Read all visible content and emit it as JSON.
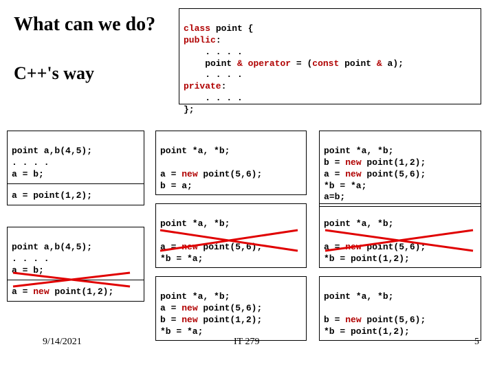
{
  "title": "What can we do?",
  "subtitle": "C++'s way",
  "classDef": "class point {\npublic:\n    . . . .\n    point & operator = (const point & a);\n    . . . .\nprivate:\n    . . . .\n};",
  "left1": "point a,b(4,5);\n. . . .\na = b;",
  "left1b": "a = point(1,2);",
  "left2": "point a,b(4,5);\n. . . .\na = b;",
  "left2b": "a = new point(1,2);",
  "mid1": "point *a, *b;\n\na = new point(5,6);\nb = a;",
  "mid2": "point *a, *b;\n\na = new point(5,6);\n*b = *a;",
  "mid3": "point *a, *b;\na = new point(5,6);\nb = new point(1,2);\n*b = *a;",
  "right1": "point *a, *b;\nb = new point(1,2);\na = new point(5,6);\n*b = *a;\na=b;",
  "right2": "point *a, *b;\n\na = new point(5,6);\n*b = point(1,2);",
  "right3": "point *a, *b;\n\nb = new point(5,6);\n*b = point(1,2);",
  "footerDate": "9/14/2021",
  "footerCenter": "IT 279",
  "footerRight": "5"
}
